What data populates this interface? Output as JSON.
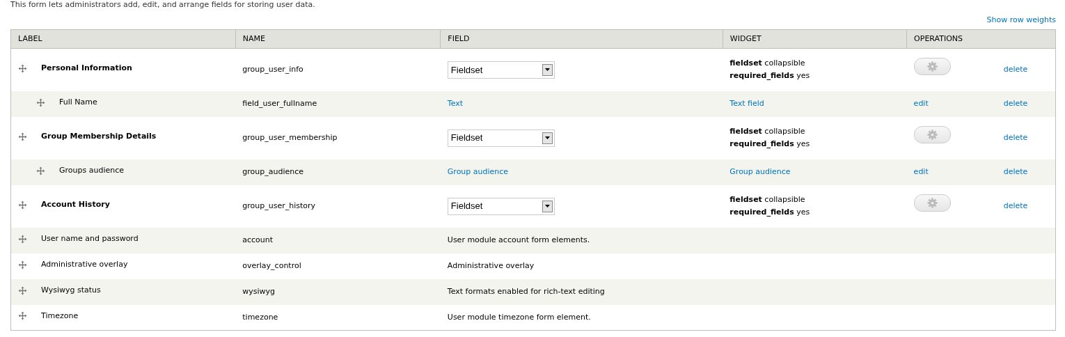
{
  "description": "This form lets administrators add, edit, and arrange fields for storing user data.",
  "show_weights_link": "Show row weights",
  "table": {
    "columns": [
      "LABEL",
      "NAME",
      "FIELD",
      "WIDGET",
      "OPERATIONS"
    ],
    "rows": [
      {
        "kind": "group",
        "label": "Personal Information",
        "name": "group_user_info",
        "field": "Fieldset",
        "widget": [
          {
            "key": "fieldset",
            "value": "collapsible"
          },
          {
            "key": "required_fields",
            "value": "yes"
          }
        ],
        "delete": "delete"
      },
      {
        "kind": "field",
        "label": "Full Name",
        "name": "field_user_fullname",
        "field": "Text",
        "widget_link": "Text field",
        "edit": "edit",
        "delete": "delete"
      },
      {
        "kind": "group",
        "label": "Group Membership Details",
        "name": "group_user_membership",
        "field": "Fieldset",
        "widget": [
          {
            "key": "fieldset",
            "value": "collapsible"
          },
          {
            "key": "required_fields",
            "value": "yes"
          }
        ],
        "delete": "delete"
      },
      {
        "kind": "field",
        "label": "Groups audience",
        "name": "group_audience",
        "field": "Group audience",
        "widget_link": "Group audience",
        "edit": "edit",
        "delete": "delete"
      },
      {
        "kind": "group",
        "label": "Account History",
        "name": "group_user_history",
        "field": "Fieldset",
        "widget": [
          {
            "key": "fieldset",
            "value": "collapsible"
          },
          {
            "key": "required_fields",
            "value": "yes"
          }
        ],
        "delete": "delete"
      },
      {
        "kind": "extra",
        "label": "User name and password",
        "name": "account",
        "field": "User module account form elements."
      },
      {
        "kind": "extra",
        "label": "Administrative overlay",
        "name": "overlay_control",
        "field": "Administrative overlay"
      },
      {
        "kind": "extra",
        "label": "Wysiwyg status",
        "name": "wysiwyg",
        "field": "Text formats enabled for rich-text editing"
      },
      {
        "kind": "extra",
        "label": "Timezone",
        "name": "timezone",
        "field": "User module timezone form element."
      }
    ]
  }
}
